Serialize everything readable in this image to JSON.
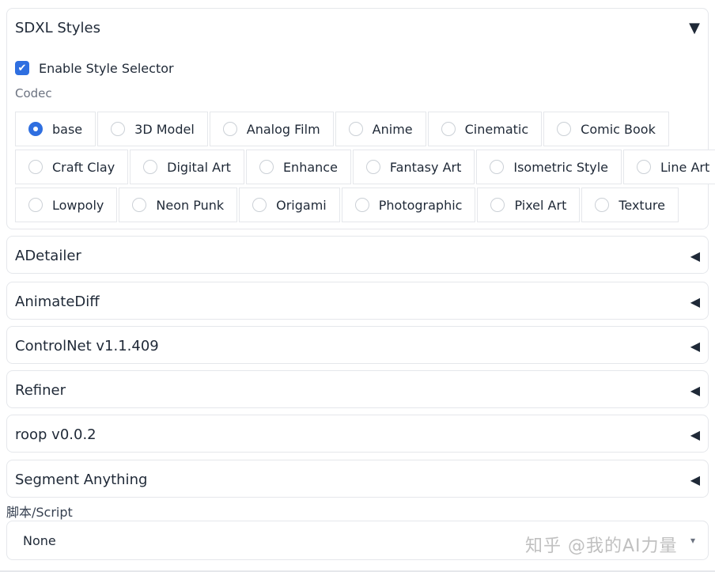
{
  "sdxl": {
    "title": "SDXL Styles",
    "enable_label": "Enable Style Selector",
    "codec_label": "Codec",
    "selected": "base",
    "styles_rows": [
      [
        "base",
        "3D Model",
        "Analog Film",
        "Anime",
        "Cinematic",
        "Comic Book"
      ],
      [
        "Craft Clay",
        "Digital Art",
        "Enhance",
        "Fantasy Art",
        "Isometric Style",
        "Line Art"
      ],
      [
        "Lowpoly",
        "Neon Punk",
        "Origami",
        "Photographic",
        "Pixel Art",
        "Texture"
      ]
    ]
  },
  "panels": [
    {
      "title": "ADetailer"
    },
    {
      "title": "AnimateDiff"
    },
    {
      "title": "ControlNet v1.1.409"
    },
    {
      "title": "Refiner"
    },
    {
      "title": "roop v0.0.2"
    },
    {
      "title": "Segment Anything"
    }
  ],
  "script": {
    "label": "脚本/Script",
    "value": "None"
  },
  "watermark": "知乎 @我的AI力量",
  "icons": {
    "expanded": "triangle-down-icon",
    "collapsed": "triangle-left-icon",
    "check": "checkmark-icon"
  },
  "colors": {
    "accent": "#2f6fe0",
    "border": "#e5e7eb"
  }
}
